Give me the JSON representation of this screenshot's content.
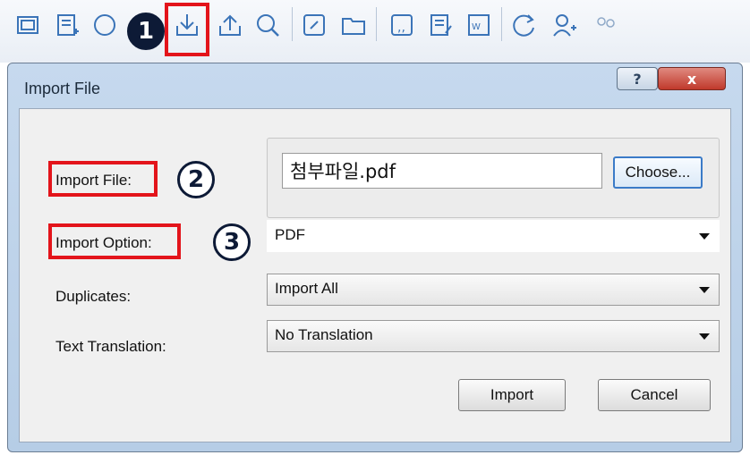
{
  "toolbar": {
    "icons": [
      "frame-icon",
      "add-list-icon",
      "globe-icon",
      "import-icon",
      "export-icon",
      "search-document-icon",
      "link-icon",
      "folder-icon",
      "quote-icon",
      "note-icon",
      "word-icon",
      "refresh-icon",
      "add-user-icon",
      "user-group-icon"
    ]
  },
  "annotations": {
    "step1": "1",
    "step2": "2",
    "step3": "3"
  },
  "dialog": {
    "title": "Import File",
    "help_label": "?",
    "close_label": "x",
    "import_file_label": "Import File:",
    "file_value": "첨부파일.pdf",
    "choose_label": "Choose...",
    "import_option_label": "Import Option:",
    "import_option_value": "PDF",
    "duplicates_label": "Duplicates:",
    "duplicates_value": "Import All",
    "translation_label": "Text Translation:",
    "translation_value": "No Translation",
    "import_button": "Import",
    "cancel_button": "Cancel"
  },
  "colors": {
    "highlight": "#e3141b",
    "badge": "#0d1a36",
    "accent": "#3b7bc8"
  }
}
